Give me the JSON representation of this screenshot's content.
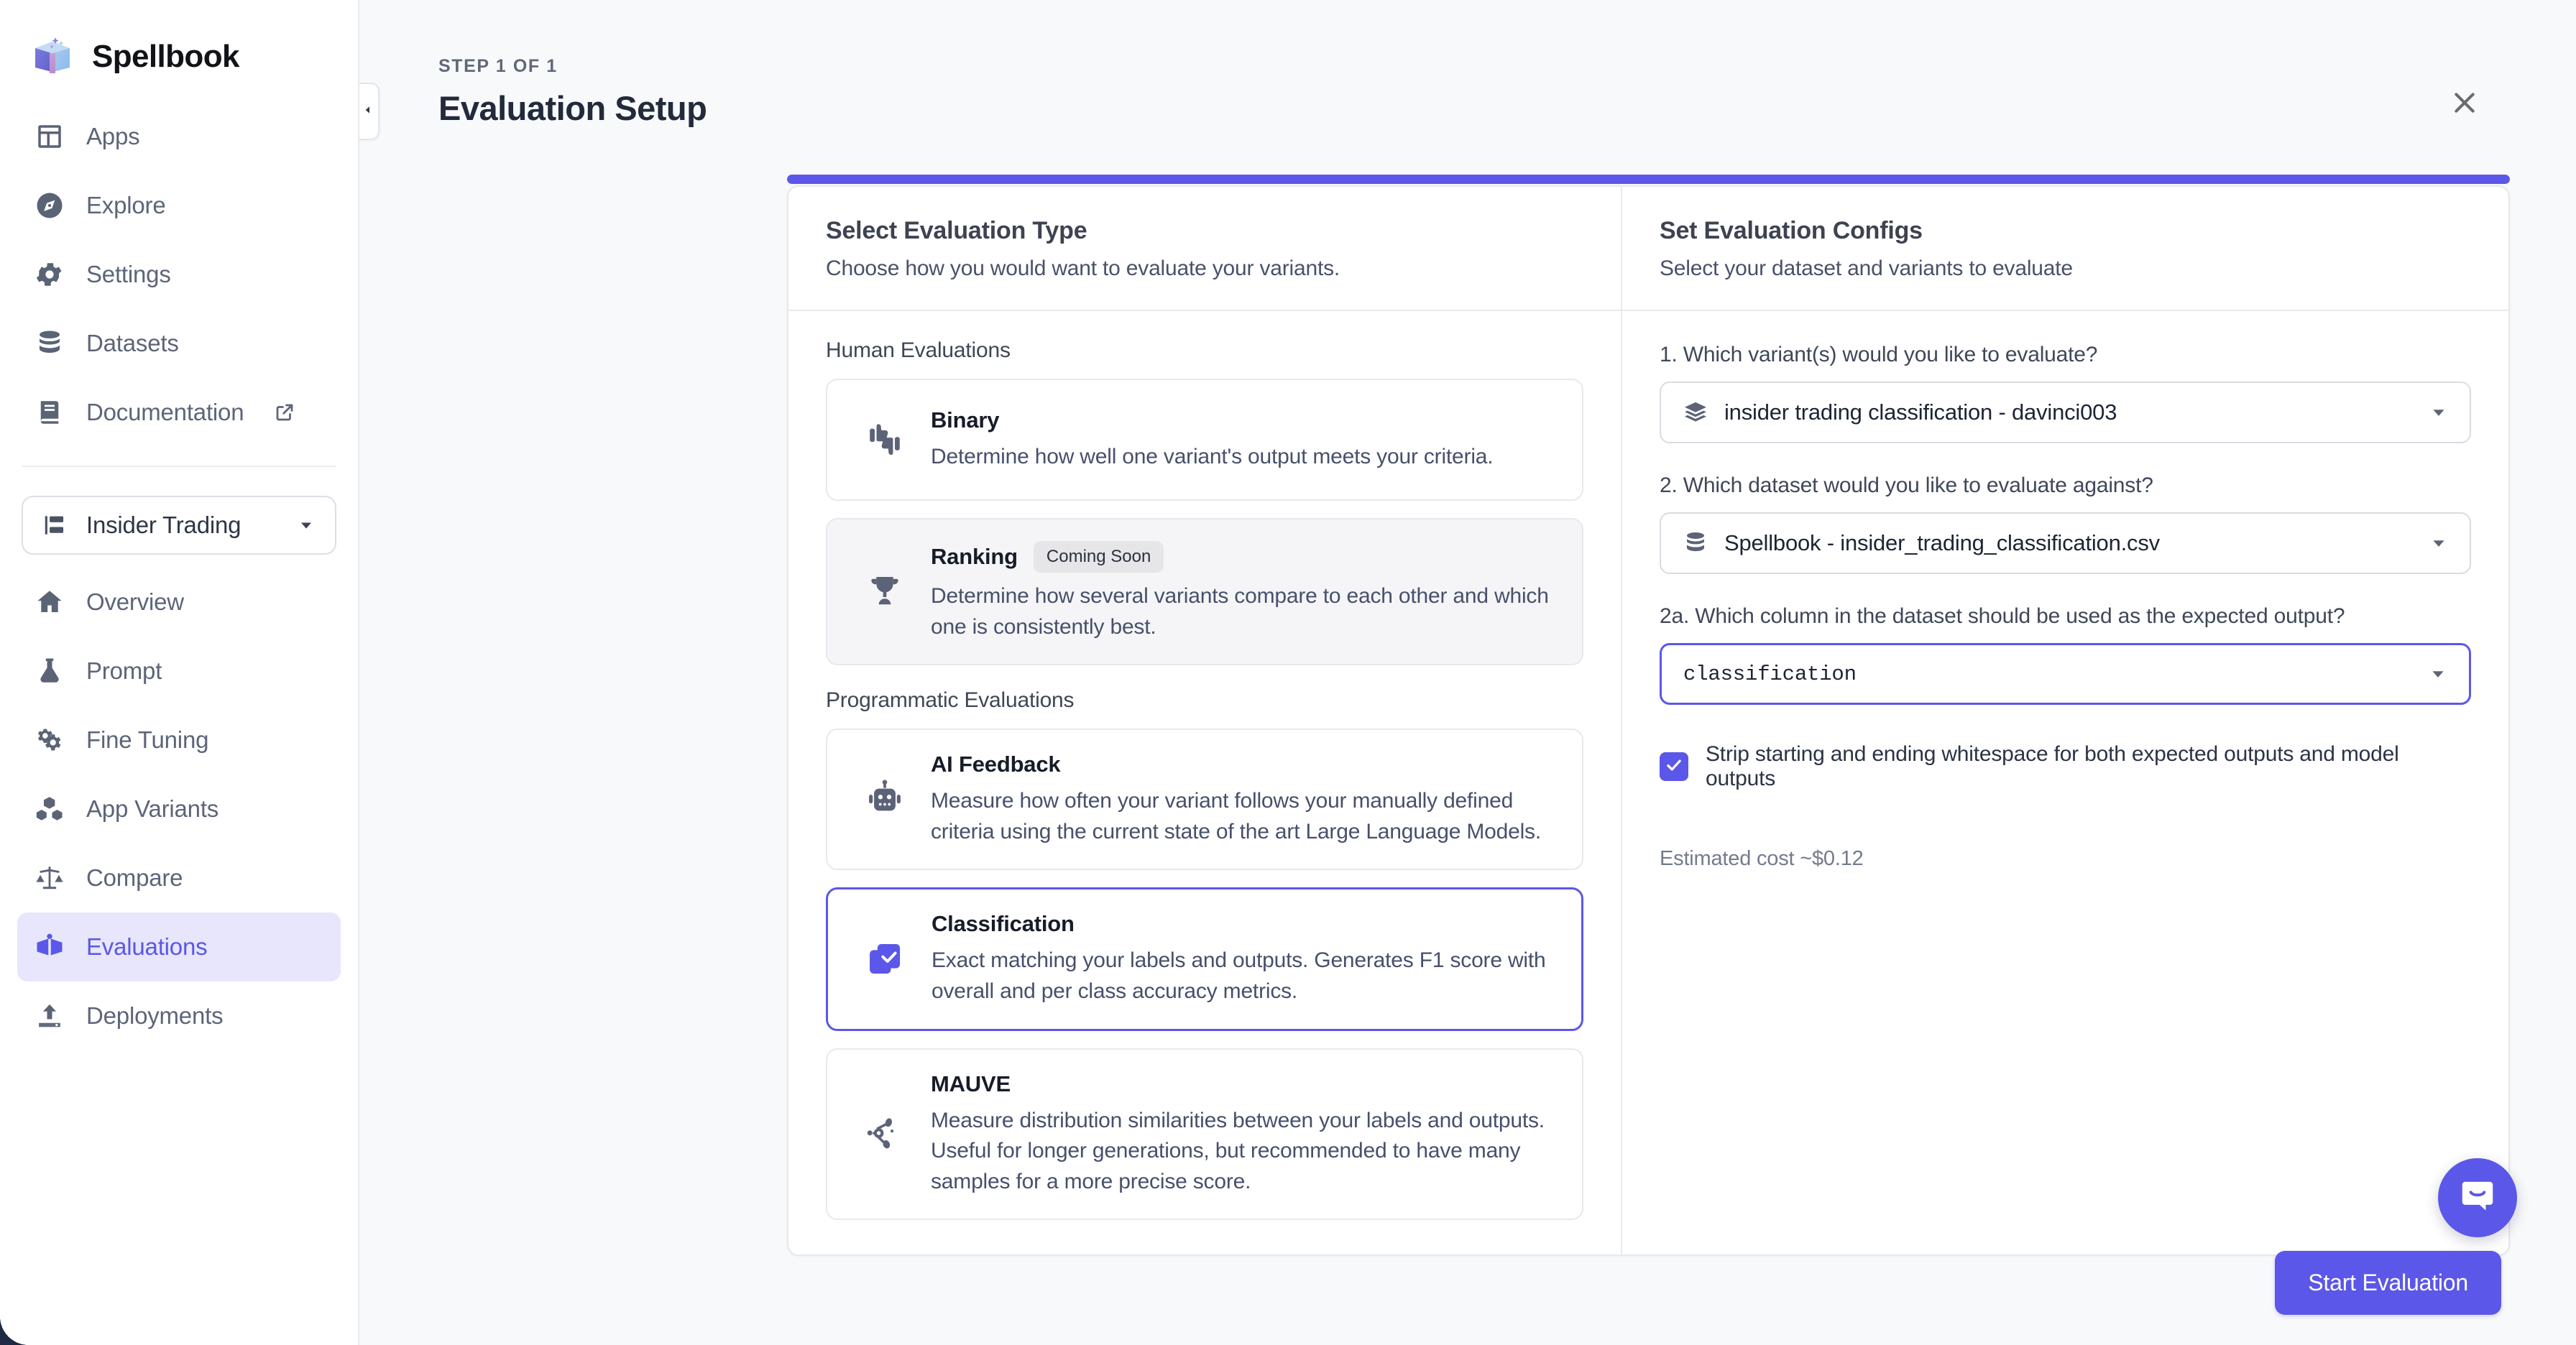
{
  "app": {
    "brand": "Spellbook"
  },
  "sidebar": {
    "nav_top": [
      {
        "label": "Apps",
        "icon": "apps-grid-icon",
        "external": false
      },
      {
        "label": "Explore",
        "icon": "compass-icon",
        "external": false
      },
      {
        "label": "Settings",
        "icon": "gear-icon",
        "external": false
      },
      {
        "label": "Datasets",
        "icon": "database-icon",
        "external": false
      },
      {
        "label": "Documentation",
        "icon": "book-icon",
        "external": true
      }
    ],
    "project": {
      "label": "Insider Trading",
      "icon": "project-tree-icon",
      "caret": "chevron-down-icon"
    },
    "nav_project": [
      {
        "label": "Overview",
        "icon": "home-icon",
        "active": false
      },
      {
        "label": "Prompt",
        "icon": "flask-icon",
        "active": false
      },
      {
        "label": "Fine Tuning",
        "icon": "gears-icon",
        "active": false
      },
      {
        "label": "App Variants",
        "icon": "boxes-icon",
        "active": false
      },
      {
        "label": "Compare",
        "icon": "scales-icon",
        "active": false
      },
      {
        "label": "Evaluations",
        "icon": "open-book-icon",
        "active": true
      },
      {
        "label": "Deployments",
        "icon": "upload-icon",
        "active": false
      }
    ]
  },
  "wizard": {
    "step_label": "STEP 1 OF 1",
    "title": "Evaluation Setup",
    "progress_percent": 100,
    "close_icon": "close-icon",
    "collapse_icon": "chevron-left-icon"
  },
  "left_panel": {
    "heading": "Select Evaluation Type",
    "subheading": "Choose how you would want to evaluate your variants.",
    "groups": [
      {
        "title": "Human Evaluations",
        "cards": [
          {
            "name": "Binary",
            "badge": "",
            "description": "Determine how well one variant's output meets your criteria.",
            "icon": "thumbs-up-down-icon",
            "selected": false,
            "muted": false
          },
          {
            "name": "Ranking",
            "badge": "Coming Soon",
            "description": "Determine how several variants compare to each other and which one is consistently best.",
            "icon": "trophy-icon",
            "selected": false,
            "muted": true
          }
        ]
      },
      {
        "title": "Programmatic Evaluations",
        "cards": [
          {
            "name": "AI Feedback",
            "badge": "",
            "description": "Measure how often your variant follows your manually defined criteria using the current state of the art Large Language Models.",
            "icon": "robot-icon",
            "selected": false,
            "muted": false
          },
          {
            "name": "Classification",
            "badge": "",
            "description": "Exact matching your labels and outputs. Generates F1 score with overall and per class accuracy metrics.",
            "icon": "checked-document-icon",
            "selected": true,
            "muted": false
          },
          {
            "name": "MAUVE",
            "badge": "",
            "description": "Measure distribution similarities between your labels and outputs. Useful for longer generations, but recommended to have many samples for a more precise score.",
            "icon": "network-nodes-icon",
            "selected": false,
            "muted": false
          }
        ]
      }
    ]
  },
  "right_panel": {
    "heading": "Set Evaluation Configs",
    "subheading": "Select your dataset and variants to evaluate",
    "questions": [
      {
        "label": "1. Which variant(s) would you like to evaluate?",
        "value": "insider trading classification - davinci003",
        "icon": "layers-icon",
        "focused": false,
        "mono": false
      },
      {
        "label": "2. Which dataset would you like to evaluate against?",
        "value": "Spellbook - insider_trading_classification.csv",
        "icon": "database-icon",
        "focused": false,
        "mono": false
      },
      {
        "label": "2a. Which column in the dataset should be used as the expected output?",
        "value": "classification",
        "icon": "",
        "focused": true,
        "mono": true
      }
    ],
    "checkbox": {
      "checked": true,
      "label": "Strip starting and ending whitespace for both expected outputs and model outputs"
    },
    "cost_note": "Estimated cost ~$0.12"
  },
  "footer": {
    "start_label": "Start Evaluation"
  },
  "support": {
    "icon": "chat-bubble-icon"
  },
  "colors": {
    "accent": "#5b57e8",
    "accent_soft": "#e7e6fd",
    "text": "#2b3345",
    "muted_text": "#5c6578",
    "border": "#e6e8ec",
    "panel_bg": "#f8f9fa",
    "badge_bg": "#e6e6e8"
  }
}
